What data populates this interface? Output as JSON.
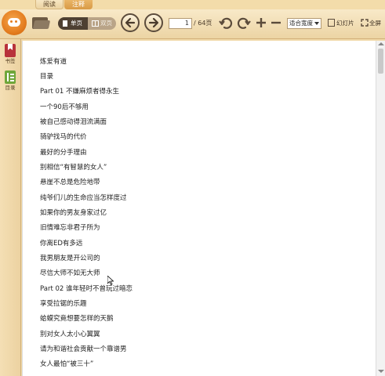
{
  "tabs": [
    {
      "label": "阅读"
    },
    {
      "label": "注释"
    }
  ],
  "toolbar": {
    "view_single": "单页",
    "view_double": "双页",
    "page_current": "1",
    "page_total": "/ 64页",
    "zoom_mode": "适合宽度",
    "slideshow": "幻灯片",
    "fullscreen": "全屏"
  },
  "sidebar": {
    "items": [
      {
        "label": "书签",
        "icon": "bookmark-icon"
      },
      {
        "label": "目录",
        "icon": "toc-icon"
      }
    ]
  },
  "document": {
    "lines": [
      "炼爱有道",
      "目录",
      "Part 01 不嫌麻烦者得永生",
      "一个90后不够用",
      "被自己感动得泪流满面",
      "骑驴找马的代价",
      "最好的分手理由",
      "别相信“有智慧的女人”",
      "悬崖不总是危险地带",
      "纯爷们儿的生命应当怎样度过",
      "如果你的男友身家过亿",
      "旧情难忘非君子所为",
      "你离ED有多远",
      "我男朋友是开公司的",
      "尽信大师不如无大师",
      "Part 02 谁年轻时不曾玩过暗恋",
      "享受拉锯的乐趣",
      "蛤蟆究竟想要怎样的天鹅",
      "别对女人太小心翼翼",
      "请为和谐社会贡献一个靠谱男",
      "女人最怕“被三十”"
    ]
  },
  "colors": {
    "toolbar_bg": "#f1d9a8",
    "accent": "#e47d1f",
    "page_bg": "#ffffff"
  }
}
